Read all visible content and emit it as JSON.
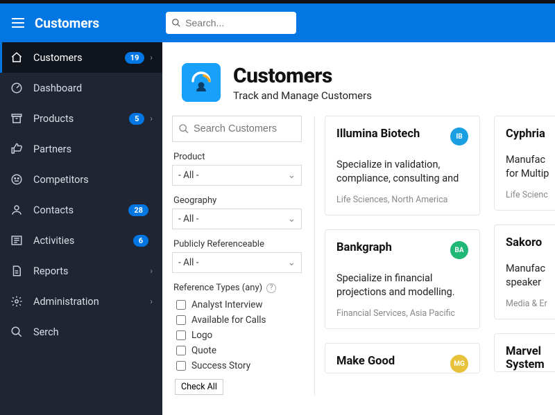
{
  "header": {
    "app_title": "Customers",
    "search_placeholder": "Search..."
  },
  "sidebar": {
    "items": [
      {
        "label": "Customers",
        "badge": "19",
        "has_chevron": true,
        "active": true
      },
      {
        "label": "Dashboard"
      },
      {
        "label": "Products",
        "badge": "5",
        "has_chevron": true
      },
      {
        "label": "Partners"
      },
      {
        "label": "Competitors"
      },
      {
        "label": "Contacts",
        "badge": "28"
      },
      {
        "label": "Activities",
        "badge": "6"
      },
      {
        "label": "Reports",
        "has_chevron": true
      },
      {
        "label": "Administration",
        "has_chevron": true
      },
      {
        "label": "Serch"
      }
    ]
  },
  "page": {
    "title": "Customers",
    "subtitle": "Track and Manage Customers"
  },
  "filters": {
    "search_placeholder": "Search Customers",
    "product_label": "Product",
    "product_value": "- All -",
    "geography_label": "Geography",
    "geography_value": "- All -",
    "publicly_label": "Publicly Referenceable",
    "publicly_value": "- All -",
    "ref_types_label": "Reference Types (any)",
    "ref_options": [
      "Analyst Interview",
      "Available for Calls",
      "Logo",
      "Quote",
      "Success Story"
    ],
    "check_all": "Check All"
  },
  "cards": {
    "col1": [
      {
        "title": "Illumina Biotech",
        "initials": "IB",
        "color": "#1a9fe3",
        "desc": "Specialize in validation, compliance, consulting and",
        "meta": "Life Sciences, North America"
      },
      {
        "title": "Bankgraph",
        "initials": "BA",
        "color": "#1fb877",
        "desc": "Specialize in financial projections and modelling.",
        "meta": "Financial Services, Asia Pacific"
      },
      {
        "title": "Make Good",
        "initials": "MG",
        "color": "#e8c23a"
      }
    ],
    "col2": [
      {
        "title": "Cyphria",
        "desc": "Manufac\nfor Multip",
        "meta": "Life Scienc"
      },
      {
        "title": "Sakoro",
        "desc": "Manufac\nspeaker",
        "meta": "Media & Er"
      },
      {
        "title": "Marvel\nSystem"
      }
    ]
  }
}
